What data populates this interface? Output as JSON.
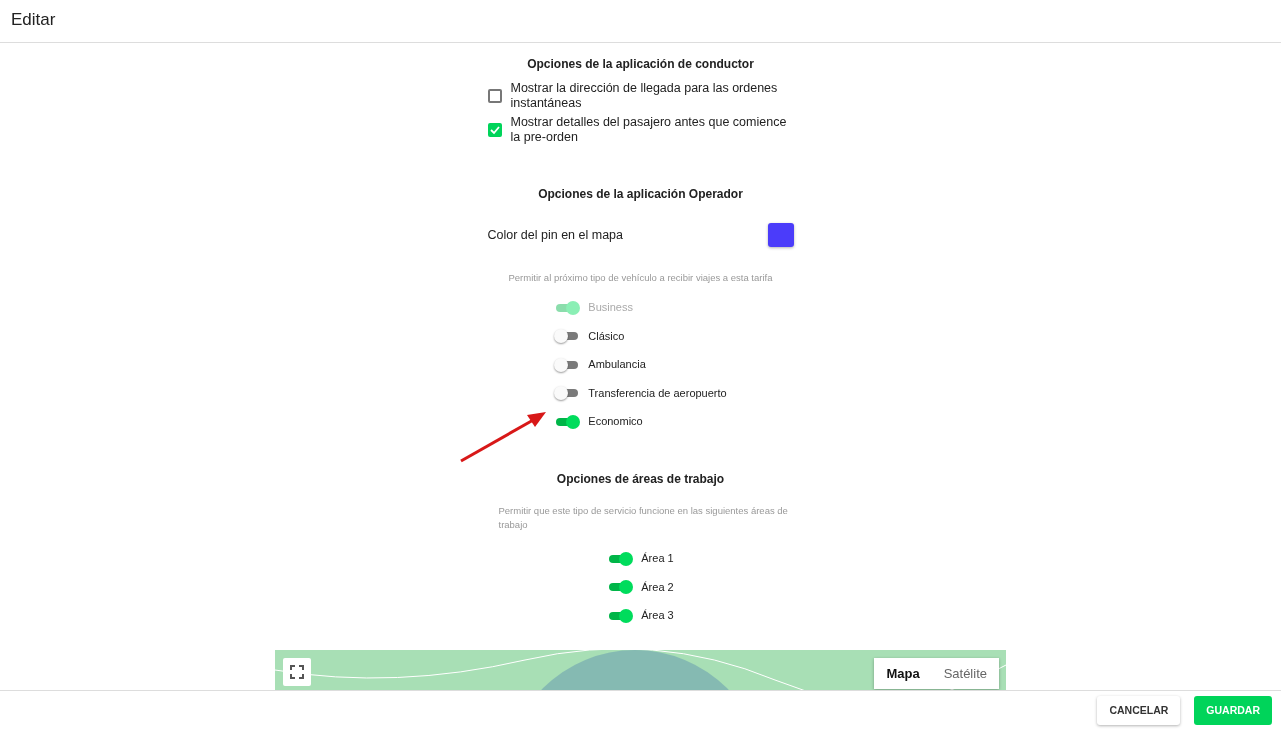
{
  "header": {
    "title": "Editar"
  },
  "driver_app": {
    "title": "Opciones de la aplicación de conductor",
    "options": [
      {
        "label": "Mostrar la dirección de llegada para las ordenes instantáneas",
        "checked": false
      },
      {
        "label": "Mostrar detalles del pasajero antes que comience la pre-orden",
        "checked": true
      }
    ]
  },
  "operator_app": {
    "title": "Opciones de la aplicación Operador",
    "pin": {
      "label": "Color del pin en el mapa",
      "color": "#4b3cfa"
    },
    "vehicle_hint": "Permitir al próximo tipo de vehículo a recibir viajes a esta tarifa",
    "vehicle_types": [
      {
        "label": "Business",
        "on": true,
        "disabled": true
      },
      {
        "label": "Clásico",
        "on": false,
        "disabled": false
      },
      {
        "label": "Ambulancia",
        "on": false,
        "disabled": false
      },
      {
        "label": "Transferencia de aeropuerto",
        "on": false,
        "disabled": false
      },
      {
        "label": "Economico",
        "on": true,
        "disabled": false
      }
    ]
  },
  "work_areas": {
    "title": "Opciones de áreas de trabajo",
    "hint": "Permitir que este tipo de servicio funcione en las siguientes áreas de trabajo",
    "areas": [
      {
        "label": "Área 1",
        "on": true
      },
      {
        "label": "Área 2",
        "on": true
      },
      {
        "label": "Área 3",
        "on": true
      }
    ]
  },
  "map": {
    "map_types": [
      {
        "label": "Mapa",
        "selected": true
      },
      {
        "label": "Satélite",
        "selected": false
      }
    ]
  },
  "footer": {
    "buttons": [
      {
        "label": "CANCELAR",
        "kind": "secondary"
      },
      {
        "label": "GUARDAR",
        "kind": "primary"
      }
    ]
  }
}
